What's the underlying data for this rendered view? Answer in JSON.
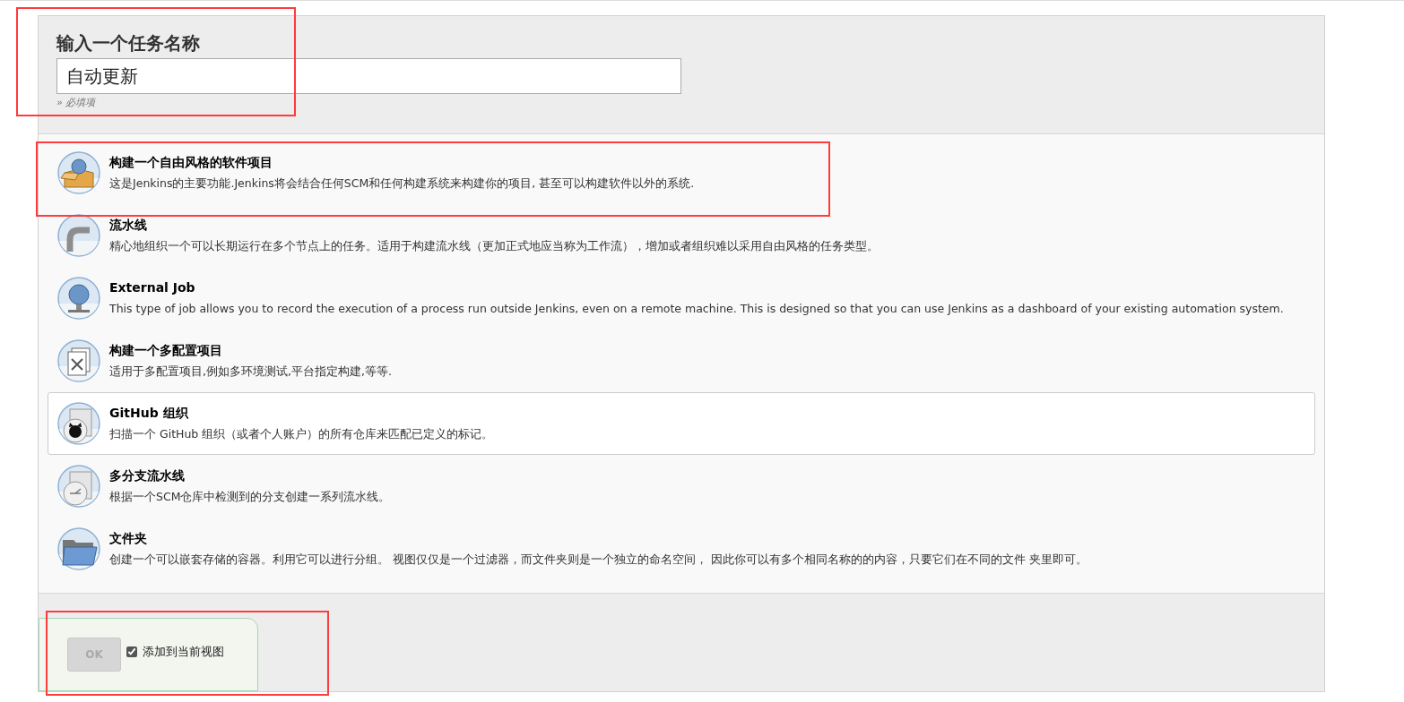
{
  "name_section": {
    "label": "输入一个任务名称",
    "value": "自动更新",
    "hint": "» 必填项"
  },
  "items": [
    {
      "kind": "freestyle",
      "title": "构建一个自由风格的软件项目",
      "description": "这是Jenkins的主要功能.Jenkins将会结合任何SCM和任何构建系统来构建你的项目, 甚至可以构建软件以外的系统.",
      "selected": false
    },
    {
      "kind": "pipeline",
      "title": "流水线",
      "description": "精心地组织一个可以长期运行在多个节点上的任务。适用于构建流水线（更加正式地应当称为工作流），增加或者组织难以采用自由风格的任务类型。",
      "selected": false
    },
    {
      "kind": "external",
      "title": "External Job",
      "description": "This type of job allows you to record the execution of a process run outside Jenkins, even on a remote machine. This is designed so that you can use Jenkins as a dashboard of your existing automation system.",
      "selected": false
    },
    {
      "kind": "matrix",
      "title": "构建一个多配置项目",
      "description": "适用于多配置项目,例如多环境测试,平台指定构建,等等.",
      "selected": false
    },
    {
      "kind": "github",
      "title": "GitHub 组织",
      "description": "扫描一个 GitHub 组织（或者个人账户）的所有仓库来匹配已定义的标记。",
      "selected": true
    },
    {
      "kind": "multibranch",
      "title": "多分支流水线",
      "description": "根据一个SCM仓库中检测到的分支创建一系列流水线。",
      "selected": false
    },
    {
      "kind": "folder",
      "title": "文件夹",
      "description": "创建一个可以嵌套存储的容器。利用它可以进行分组。 视图仅仅是一个过滤器，而文件夹则是一个独立的命名空间， 因此你可以有多个相同名称的的内容，只要它们在不同的文件 夹里即可。",
      "selected": false
    }
  ],
  "footer": {
    "ok_button": {
      "label": "OK",
      "disabled": true
    },
    "add_to_view": {
      "label": "添加到当前视图",
      "checked": true
    }
  }
}
